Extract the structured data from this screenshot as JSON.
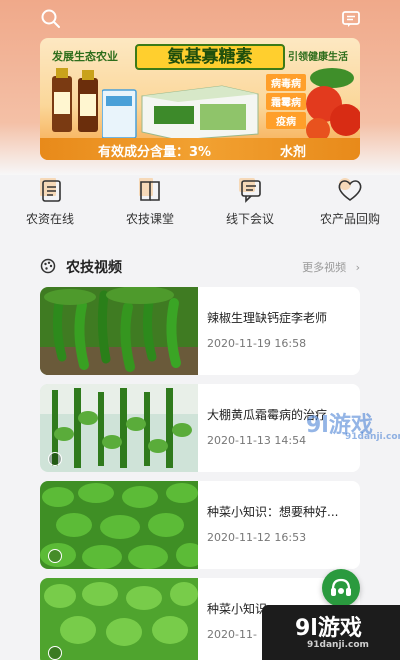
{
  "header": {
    "search_icon": "search-icon",
    "message_icon": "message-icon"
  },
  "banner": {
    "left_title": "发展生态农业",
    "main_title": "氨基寡糖素",
    "right_title": "引领健康生活",
    "tags": [
      "病毒病",
      "霜霉病",
      "疫病"
    ],
    "footer_left": "有效成分含量：3%",
    "footer_right": "水剂"
  },
  "quick_nav": [
    {
      "label": "农资在线",
      "icon": "form-icon"
    },
    {
      "label": "农技课堂",
      "icon": "book-icon"
    },
    {
      "label": "线下会议",
      "icon": "chat-icon"
    },
    {
      "label": "农产品回购",
      "icon": "heart-icon"
    }
  ],
  "section": {
    "title": "农技视频",
    "more": "更多视频"
  },
  "videos": [
    {
      "title": "辣椒生理缺钙症李老师",
      "date": "2020-11-19 16:58"
    },
    {
      "title": "大棚黄瓜霜霉病的治疗",
      "date": "2020-11-13 14:54"
    },
    {
      "title": "种菜小知识：想要种好...",
      "date": "2020-11-12 16:53"
    },
    {
      "title": "种菜小知识：",
      "date": "2020-11-"
    }
  ],
  "watermarks": {
    "brand": "9l游戏",
    "site": "91danji.com"
  },
  "colors": {
    "accent_green": "#2a9a3e",
    "header_orange": "#f0a98a"
  }
}
